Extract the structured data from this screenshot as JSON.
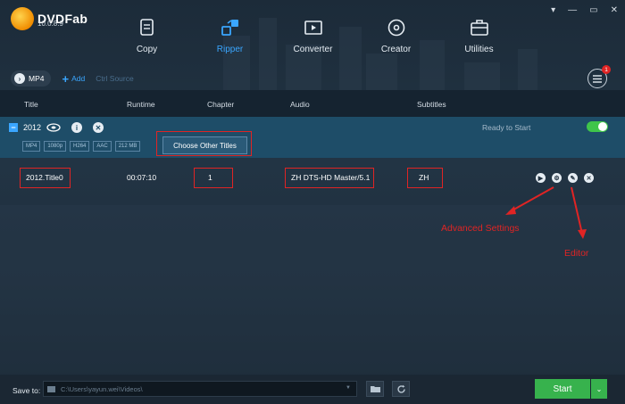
{
  "app": {
    "name": "DVDFab",
    "version": "10.0.8.9"
  },
  "window": {
    "controls": [
      "▾",
      "—",
      "▭",
      "✕"
    ]
  },
  "modules": [
    {
      "label": "Copy",
      "icon": "copy-icon",
      "active": false
    },
    {
      "label": "Ripper",
      "icon": "ripper-icon",
      "active": true
    },
    {
      "label": "Converter",
      "icon": "converter-icon",
      "active": false
    },
    {
      "label": "Creator",
      "icon": "creator-icon",
      "active": false
    },
    {
      "label": "Utilities",
      "icon": "utilities-icon",
      "active": false
    }
  ],
  "toolbar": {
    "format": "MP4",
    "add": "Add",
    "faded": "Ctrl Source",
    "queue_badge": "1"
  },
  "columns": [
    "Title",
    "Runtime",
    "Chapter",
    "Audio",
    "Subtitles"
  ],
  "source": {
    "name": "2012",
    "status": "Ready to Start",
    "tags": [
      "MP4",
      "1080p",
      "H264",
      "AAC",
      "212 MB"
    ],
    "choose_button": "Choose Other Titles"
  },
  "row": {
    "title": "2012.Title0",
    "runtime": "00:07:10",
    "chapter": "1",
    "audio": "ZH  DTS-HD Master/5.1",
    "subtitles": "ZH"
  },
  "annotations": {
    "advanced": "Advanced Settings",
    "editor": "Editor"
  },
  "bottom": {
    "save_to": "Save to:",
    "path": "C:\\Users\\yayun.wei\\Videos\\",
    "start": "Start"
  },
  "colors": {
    "accent": "#3aa6ff",
    "highlight": "#e02424",
    "start": "#37b24d",
    "toggle": "#3fc54a"
  }
}
